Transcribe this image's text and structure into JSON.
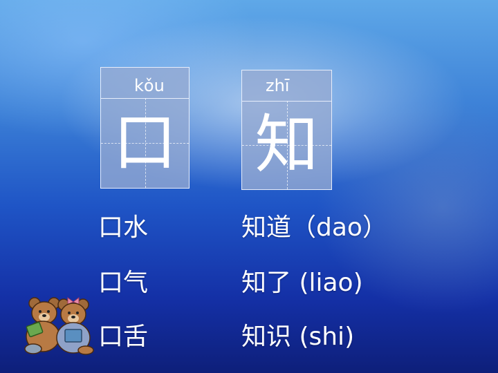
{
  "cards": [
    {
      "pinyin": "kǒu",
      "hanzi": "口"
    },
    {
      "pinyin": "zhī",
      "hanzi": "知"
    }
  ],
  "left_words": [
    "口水",
    "口气",
    "口舌"
  ],
  "right_words": [
    "知道（dao）",
    "知了 (liao)",
    "知识 (shi)"
  ],
  "decoration": {
    "icon": "teddy-bears-icon"
  },
  "colors": {
    "card_bg": "#96aad2",
    "text": "#ffffff",
    "bg_deep": "#1430a6"
  }
}
